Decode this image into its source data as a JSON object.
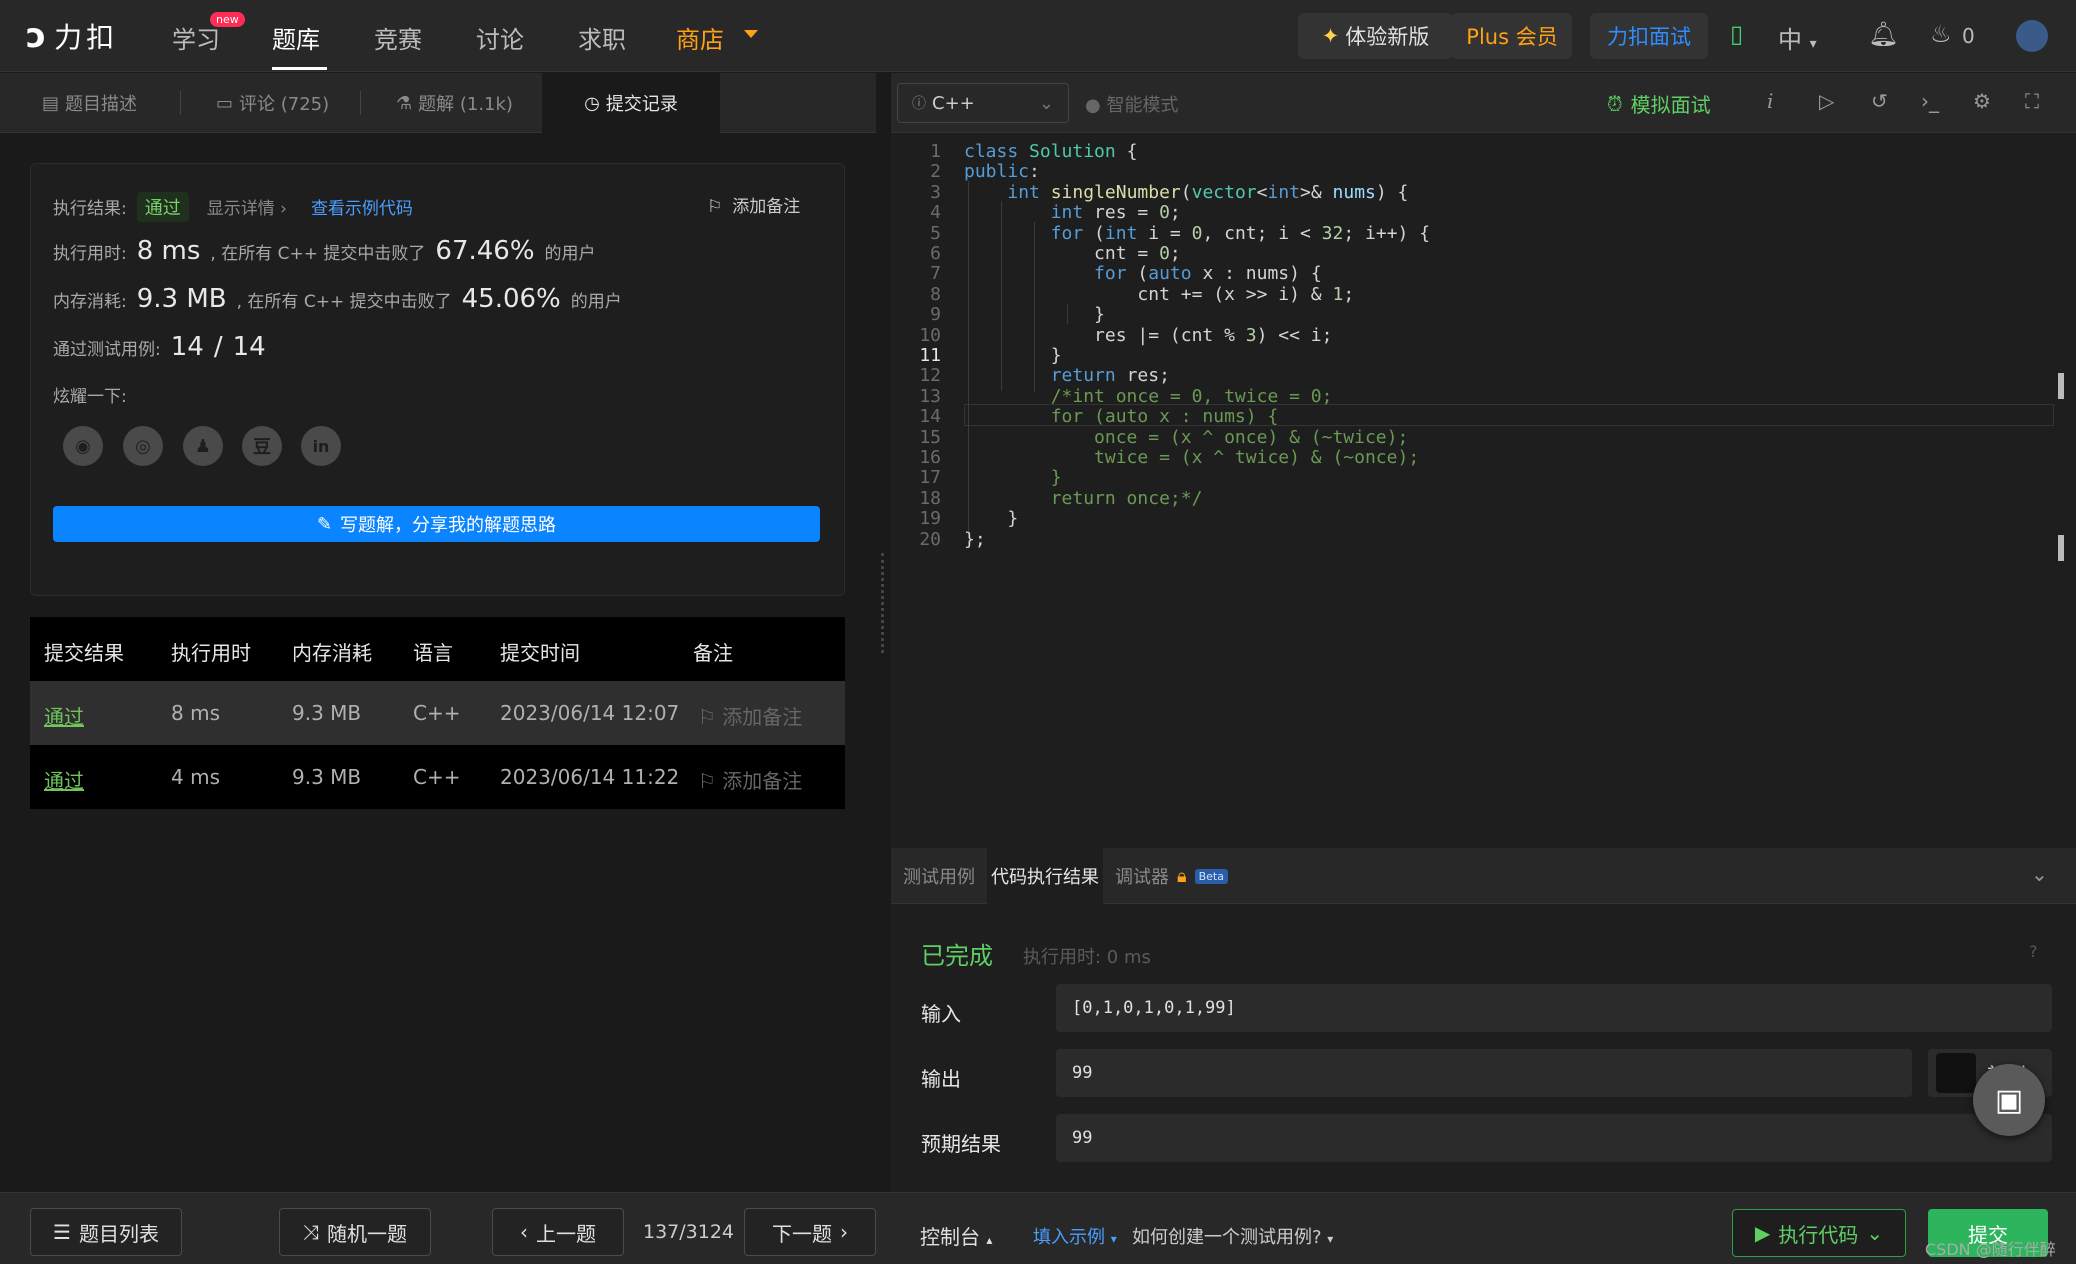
{
  "nav": {
    "logo_text": "力扣",
    "items": [
      {
        "label": "学习",
        "badge": "new"
      },
      {
        "label": "题库"
      },
      {
        "label": "竞赛"
      },
      {
        "label": "讨论"
      },
      {
        "label": "求职"
      },
      {
        "label": "商店"
      }
    ],
    "try_new": "体验新版",
    "plus": "Plus 会员",
    "interview": "力扣面试",
    "lang": "中",
    "fire_count": "0"
  },
  "left_tabs": [
    {
      "label": "题目描述"
    },
    {
      "label": "评论 (725)"
    },
    {
      "label": "题解 (1.1k)"
    },
    {
      "label": "提交记录"
    }
  ],
  "result": {
    "status_label": "执行结果:",
    "status": "通过",
    "show_detail": "显示详情 ›",
    "view_sample": "查看示例代码",
    "add_note": "添加备注",
    "runtime_label": "执行用时:",
    "runtime_value": "8 ms",
    "runtime_mid": ", 在所有 C++ 提交中击败了",
    "runtime_pct": "67.46%",
    "runtime_suffix": "的用户",
    "memory_label": "内存消耗:",
    "memory_value": "9.3 MB",
    "memory_mid": ", 在所有 C++ 提交中击败了",
    "memory_pct": "45.06%",
    "memory_suffix": "的用户",
    "cases_label": "通过测试用例:",
    "cases_passed": "14",
    "cases_sep": "/",
    "cases_total": "14",
    "share_label": "炫耀一下:",
    "share_icons": [
      "wechat-icon",
      "weibo-icon",
      "qq-icon",
      "douban-icon",
      "linkedin-icon"
    ],
    "write_btn": "写题解，分享我的解题思路"
  },
  "submissions": {
    "headers": [
      "提交结果",
      "执行用时",
      "内存消耗",
      "语言",
      "提交时间",
      "备注"
    ],
    "rows": [
      {
        "status": "通过",
        "time": "8 ms",
        "memory": "9.3 MB",
        "lang": "C++",
        "date": "2023/06/14 12:07",
        "note": "添加备注"
      },
      {
        "status": "通过",
        "time": "4 ms",
        "memory": "9.3 MB",
        "lang": "C++",
        "date": "2023/06/14 11:22",
        "note": "添加备注"
      }
    ]
  },
  "bottom": {
    "problem_list": "题目列表",
    "random": "随机一题",
    "prev": "上一题",
    "counter": "137/3124",
    "next": "下一题",
    "console": "控制台",
    "fill_example": "填入示例",
    "how_create": "如何创建一个测试用例?",
    "run": "执行代码",
    "submit": "提交"
  },
  "editor": {
    "language": "C++",
    "ai_mode": "智能模式",
    "mock_interview": "模拟面试",
    "current_line": 11
  },
  "console": {
    "tabs": [
      "测试用例",
      "代码执行结果",
      "调试器"
    ],
    "beta": "Beta",
    "status": "已完成",
    "exec_time": "执行用时: 0 ms",
    "input_label": "输入",
    "input_value": "[0,1,0,1,0,1,99]",
    "output_label": "输出",
    "output_value": "99",
    "diff_label": "差别",
    "expected_label": "预期结果",
    "expected_value": "99"
  },
  "watermark": "CSDN @随行伴醉",
  "colors": {
    "accent_blue": "#0a84ff",
    "pass_green": "#6fc45a",
    "shop_orange": "#ffa116"
  }
}
